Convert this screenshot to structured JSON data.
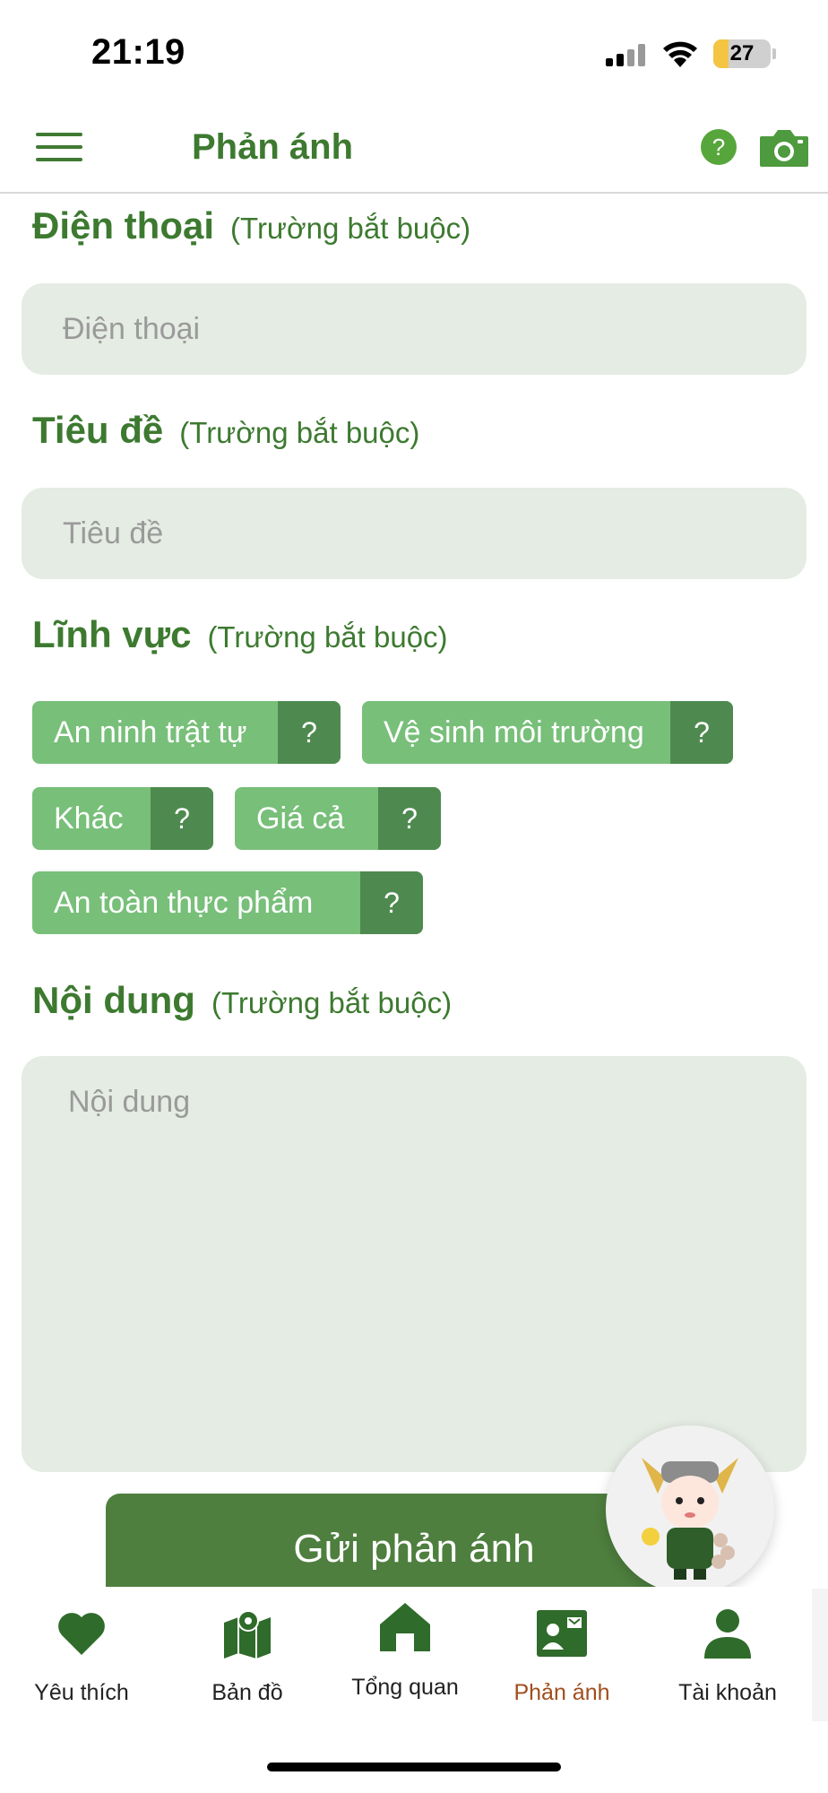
{
  "status_bar": {
    "time": "21:19",
    "battery": "27",
    "battery_level": 0.27
  },
  "header": {
    "title": "Phản ánh",
    "help_label": "?"
  },
  "form": {
    "required_note": "(Trường bắt buộc)",
    "phone": {
      "label": "Điện thoại",
      "placeholder": "Điện thoại"
    },
    "title": {
      "label": "Tiêu đề",
      "placeholder": "Tiêu đề"
    },
    "field": {
      "label": "Lĩnh vực",
      "chips": [
        {
          "label": "An ninh trật tự",
          "help": "?"
        },
        {
          "label": "Vệ sinh môi trường",
          "help": "?"
        },
        {
          "label": "Khác",
          "help": "?"
        },
        {
          "label": "Giá cả",
          "help": "?"
        },
        {
          "label": "An toàn thực phẩm",
          "help": "?"
        }
      ]
    },
    "content": {
      "label": "Nội dung",
      "placeholder": "Nội dung"
    },
    "submit_label": "Gửi phản ánh"
  },
  "tabbar": {
    "items": [
      {
        "label": "Yêu thích",
        "icon": "heart-icon"
      },
      {
        "label": "Bản đồ",
        "icon": "map-icon"
      },
      {
        "label": "Tổng quan",
        "icon": "home-icon"
      },
      {
        "label": "Phản ánh",
        "icon": "feedback-icon",
        "active": true
      },
      {
        "label": "Tài khoản",
        "icon": "user-icon"
      }
    ]
  },
  "colors": {
    "primary": "#3d7a30",
    "chip": "#78bf7a",
    "chip_help": "#4e8a4f",
    "input_bg": "#e5ece3",
    "active_tab": "#a14d1c"
  }
}
